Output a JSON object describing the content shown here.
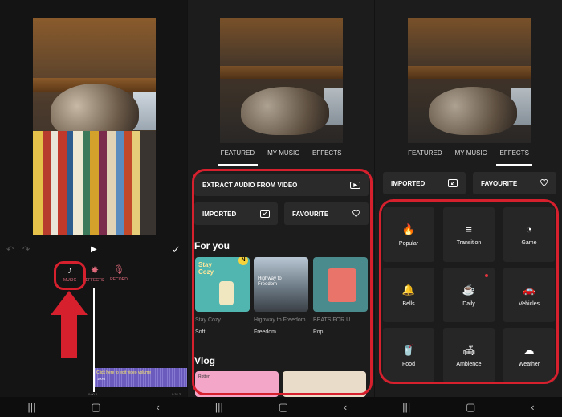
{
  "editor": {
    "tools": [
      {
        "label": "MUSIC",
        "icon": "music-note-icon"
      },
      {
        "label": "EFFECTS",
        "icon": "sparkle-icon"
      },
      {
        "label": "RECORD",
        "icon": "microphone-icon"
      }
    ],
    "timeline": {
      "hint": "Click here to edit video volume",
      "volume": "100%",
      "start_time": "0:00.0",
      "end_time": "0:34.2"
    }
  },
  "music": {
    "tabs": [
      "FEATURED",
      "MY MUSIC",
      "EFFECTS"
    ],
    "extract_label": "EXTRACT AUDIO FROM VIDEO",
    "imported_label": "IMPORTED",
    "favourite_label": "FAVOURITE",
    "for_you_heading": "For you",
    "tracks": [
      {
        "art_text": "Stay Cozy",
        "title": "Stay Cozy",
        "category": "Soft",
        "badge": "N"
      },
      {
        "art_text": "Highway to Freedom",
        "title": "Highway to Freedom",
        "category": "Freedom"
      },
      {
        "art_text": "",
        "title": "BEATS FOR U",
        "category": "Pop"
      }
    ],
    "vlog_heading": "Vlog",
    "vlog_item": "Rotten"
  },
  "effects": {
    "tabs": [
      "FEATURED",
      "MY MUSIC",
      "EFFECTS"
    ],
    "imported_label": "IMPORTED",
    "favourite_label": "FAVOURITE",
    "categories": [
      {
        "label": "Popular",
        "icon": "flame-icon"
      },
      {
        "label": "Transition",
        "icon": "transition-lines-icon"
      },
      {
        "label": "Game",
        "icon": "pacman-icon"
      },
      {
        "label": "Bells",
        "icon": "bell-icon"
      },
      {
        "label": "Daily",
        "icon": "cup-icon"
      },
      {
        "label": "Vehicles",
        "icon": "car-icon"
      },
      {
        "label": "Food",
        "icon": "drink-icon"
      },
      {
        "label": "Ambience",
        "icon": "ambience-icon"
      },
      {
        "label": "Weather",
        "icon": "cloud-icon"
      }
    ]
  },
  "colors": {
    "accent_red": "#d6202e",
    "tool_pink": "#e06a7c",
    "music_purple": "#6a5bbd"
  }
}
